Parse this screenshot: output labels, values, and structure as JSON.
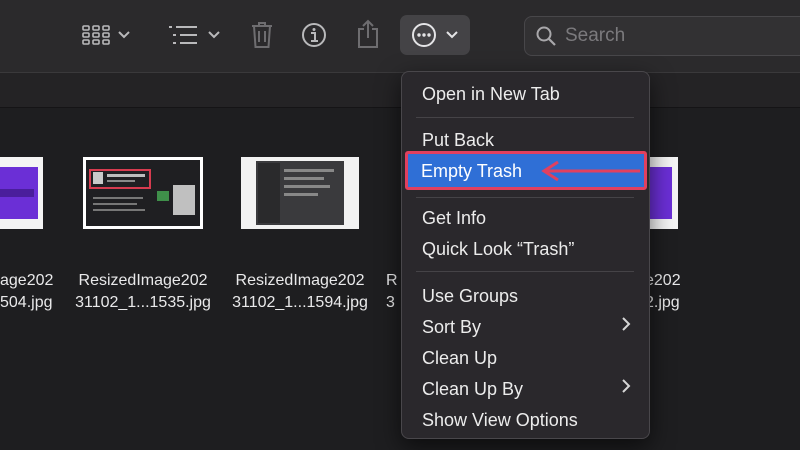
{
  "toolbar": {
    "search_placeholder": "Search"
  },
  "files": [
    {
      "line1": "age202",
      "line2": "504.jpg"
    },
    {
      "line1": "ResizedImage202",
      "line2": "31102_1...1535.jpg"
    },
    {
      "line1": "ResizedImage202",
      "line2": "31102_1...1594.jpg"
    },
    {
      "line1": "R",
      "line2": "3"
    },
    {
      "line1": "e202",
      "line2": "2.jpg"
    }
  ],
  "menu": {
    "items": [
      {
        "label": "Open in New Tab"
      },
      {
        "label": "Put Back"
      },
      {
        "label": "Empty Trash"
      },
      {
        "label": "Get Info"
      },
      {
        "label": "Quick Look “Trash”"
      },
      {
        "label": "Use Groups"
      },
      {
        "label": "Sort By"
      },
      {
        "label": "Clean Up"
      },
      {
        "label": "Clean Up By"
      },
      {
        "label": "Show View Options"
      }
    ]
  },
  "colors": {
    "highlight": "#2f6fd6",
    "annotation": "#e0405f"
  }
}
